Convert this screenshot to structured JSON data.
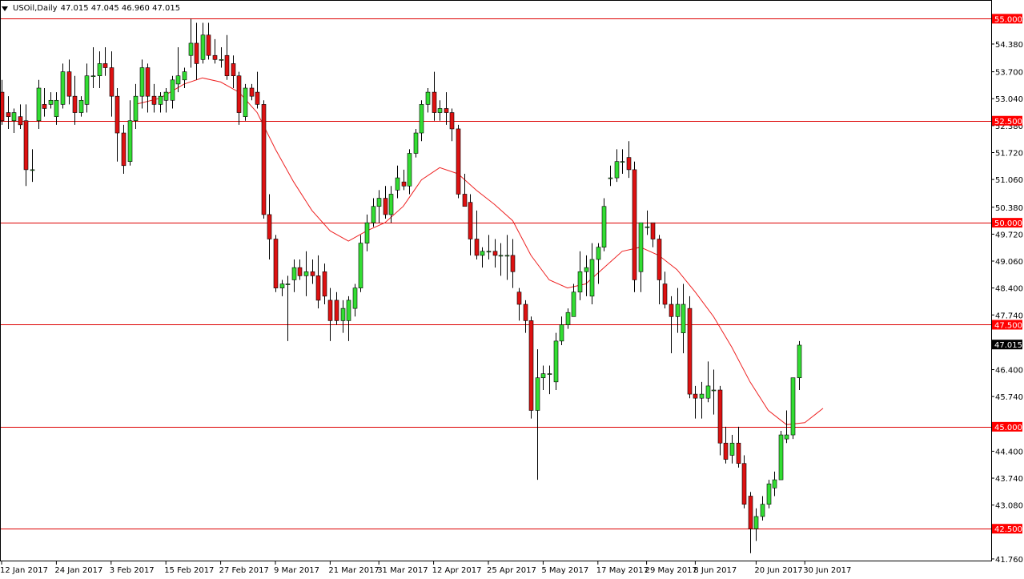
{
  "window": {
    "symbol": "USOil",
    "timeframe": "Daily",
    "header_symbol_tf": "USOil,Daily",
    "ohlc_text": "47.015 47.045 46.960 47.015"
  },
  "colors": {
    "bull": "#33dd33",
    "bear": "#dd1111",
    "level_line": "#dd0000",
    "ma_line": "#ee2222",
    "axis": "#000000",
    "current_tag_bg": "#000000",
    "level_tag_bg": "#ff0000"
  },
  "chart_data": {
    "type": "candlestick",
    "y_axis": {
      "min": 41.7,
      "max": 55.4,
      "ticks": [
        "55.000",
        "54.380",
        "53.700",
        "53.040",
        "52.380",
        "51.720",
        "51.060",
        "50.380",
        "49.720",
        "49.060",
        "48.400",
        "47.740",
        "46.400",
        "45.740",
        "44.400",
        "43.740",
        "43.080",
        "41.760"
      ]
    },
    "x_axis": {
      "tick_labels": [
        "12 Jan 2017",
        "24 Jan 2017",
        "3 Feb 2017",
        "15 Feb 2017",
        "27 Feb 2017",
        "9 Mar 2017",
        "21 Mar 2017",
        "31 Mar 2017",
        "12 Apr 2017",
        "25 Apr 2017",
        "5 May 2017",
        "17 May 2017",
        "29 May 2017",
        "8 Jun 2017",
        "20 Jun 2017",
        "30 Jun 2017"
      ],
      "tick_bar_index": [
        0,
        9,
        18,
        27,
        36,
        45,
        54,
        62,
        71,
        80,
        89,
        98,
        106,
        114,
        124,
        132
      ]
    },
    "horizontal_levels": [
      {
        "value": 55.0,
        "label": "55.000"
      },
      {
        "value": 52.5,
        "label": "52.500"
      },
      {
        "value": 50.0,
        "label": "50.000"
      },
      {
        "value": 47.5,
        "label": "47.500"
      },
      {
        "value": 45.0,
        "label": "45.000"
      },
      {
        "value": 42.5,
        "label": "42.500"
      }
    ],
    "current_price": {
      "value": 47.015,
      "label": "47.015"
    },
    "moving_average": {
      "type": "SMA",
      "points": [
        {
          "i": 22,
          "v": 52.9
        },
        {
          "i": 26,
          "v": 53.05
        },
        {
          "i": 30,
          "v": 53.4
        },
        {
          "i": 33,
          "v": 53.55
        },
        {
          "i": 36,
          "v": 53.45
        },
        {
          "i": 39,
          "v": 53.2
        },
        {
          "i": 42,
          "v": 52.7
        },
        {
          "i": 45,
          "v": 51.8
        },
        {
          "i": 48,
          "v": 51.0
        },
        {
          "i": 51,
          "v": 50.3
        },
        {
          "i": 54,
          "v": 49.8
        },
        {
          "i": 57,
          "v": 49.55
        },
        {
          "i": 60,
          "v": 49.8
        },
        {
          "i": 63,
          "v": 50.0
        },
        {
          "i": 66,
          "v": 50.4
        },
        {
          "i": 69,
          "v": 51.05
        },
        {
          "i": 72,
          "v": 51.35
        },
        {
          "i": 75,
          "v": 51.2
        },
        {
          "i": 78,
          "v": 50.8
        },
        {
          "i": 81,
          "v": 50.45
        },
        {
          "i": 84,
          "v": 50.05
        },
        {
          "i": 87,
          "v": 49.2
        },
        {
          "i": 90,
          "v": 48.6
        },
        {
          "i": 93,
          "v": 48.4
        },
        {
          "i": 96,
          "v": 48.5
        },
        {
          "i": 99,
          "v": 48.9
        },
        {
          "i": 102,
          "v": 49.3
        },
        {
          "i": 105,
          "v": 49.4
        },
        {
          "i": 108,
          "v": 49.2
        },
        {
          "i": 111,
          "v": 48.85
        },
        {
          "i": 114,
          "v": 48.3
        },
        {
          "i": 117,
          "v": 47.7
        },
        {
          "i": 120,
          "v": 46.95
        },
        {
          "i": 123,
          "v": 46.1
        },
        {
          "i": 126,
          "v": 45.4
        },
        {
          "i": 129,
          "v": 45.05
        },
        {
          "i": 132,
          "v": 45.1
        },
        {
          "i": 135,
          "v": 45.45
        }
      ]
    },
    "candles": [
      {
        "o": 53.2,
        "h": 53.5,
        "l": 52.4,
        "c": 52.5
      },
      {
        "o": 52.7,
        "h": 53.1,
        "l": 52.3,
        "c": 52.6
      },
      {
        "o": 52.5,
        "h": 52.8,
        "l": 52.2,
        "c": 52.7
      },
      {
        "o": 52.6,
        "h": 52.9,
        "l": 52.3,
        "c": 52.4
      },
      {
        "o": 52.5,
        "h": 52.9,
        "l": 50.9,
        "c": 51.3
      },
      {
        "o": 51.3,
        "h": 51.8,
        "l": 51.0,
        "c": 51.3
      },
      {
        "o": 52.5,
        "h": 53.5,
        "l": 52.3,
        "c": 53.3
      },
      {
        "o": 52.9,
        "h": 53.3,
        "l": 52.6,
        "c": 52.8
      },
      {
        "o": 52.9,
        "h": 53.2,
        "l": 52.8,
        "c": 53.0
      },
      {
        "o": 52.6,
        "h": 53.2,
        "l": 52.4,
        "c": 53.0
      },
      {
        "o": 52.9,
        "h": 53.9,
        "l": 52.8,
        "c": 53.7
      },
      {
        "o": 53.7,
        "h": 54.0,
        "l": 52.9,
        "c": 53.1
      },
      {
        "o": 53.1,
        "h": 53.6,
        "l": 52.4,
        "c": 52.7
      },
      {
        "o": 52.7,
        "h": 53.1,
        "l": 52.6,
        "c": 53.0
      },
      {
        "o": 52.9,
        "h": 53.9,
        "l": 52.7,
        "c": 53.6
      },
      {
        "o": 53.6,
        "h": 54.3,
        "l": 53.3,
        "c": 53.6
      },
      {
        "o": 53.6,
        "h": 54.2,
        "l": 53.3,
        "c": 53.9
      },
      {
        "o": 53.9,
        "h": 54.3,
        "l": 53.6,
        "c": 53.8
      },
      {
        "o": 53.8,
        "h": 54.2,
        "l": 52.6,
        "c": 53.1
      },
      {
        "o": 53.1,
        "h": 53.3,
        "l": 51.5,
        "c": 52.2
      },
      {
        "o": 52.2,
        "h": 52.4,
        "l": 51.2,
        "c": 51.4
      },
      {
        "o": 51.5,
        "h": 53.0,
        "l": 51.4,
        "c": 52.5
      },
      {
        "o": 52.5,
        "h": 53.4,
        "l": 52.3,
        "c": 53.1
      },
      {
        "o": 53.1,
        "h": 54.0,
        "l": 52.8,
        "c": 53.8
      },
      {
        "o": 53.8,
        "h": 53.9,
        "l": 52.7,
        "c": 53.1
      },
      {
        "o": 53.1,
        "h": 53.4,
        "l": 52.7,
        "c": 52.9
      },
      {
        "o": 52.9,
        "h": 53.2,
        "l": 52.7,
        "c": 53.1
      },
      {
        "o": 53.0,
        "h": 53.3,
        "l": 52.7,
        "c": 53.2
      },
      {
        "o": 53.0,
        "h": 53.6,
        "l": 52.8,
        "c": 53.5
      },
      {
        "o": 53.4,
        "h": 54.3,
        "l": 53.2,
        "c": 53.6
      },
      {
        "o": 53.5,
        "h": 53.8,
        "l": 53.3,
        "c": 53.7
      },
      {
        "o": 54.1,
        "h": 55.0,
        "l": 53.8,
        "c": 54.4
      },
      {
        "o": 54.4,
        "h": 54.9,
        "l": 53.5,
        "c": 53.9
      },
      {
        "o": 54.0,
        "h": 54.9,
        "l": 53.9,
        "c": 54.6
      },
      {
        "o": 54.6,
        "h": 54.9,
        "l": 54.0,
        "c": 54.1
      },
      {
        "o": 54.1,
        "h": 54.5,
        "l": 53.9,
        "c": 54.0
      },
      {
        "o": 54.0,
        "h": 54.3,
        "l": 53.8,
        "c": 54.0
      },
      {
        "o": 54.1,
        "h": 54.6,
        "l": 53.5,
        "c": 53.6
      },
      {
        "o": 53.9,
        "h": 54.1,
        "l": 53.3,
        "c": 53.6
      },
      {
        "o": 53.6,
        "h": 53.7,
        "l": 52.4,
        "c": 52.7
      },
      {
        "o": 52.6,
        "h": 53.4,
        "l": 52.5,
        "c": 53.3
      },
      {
        "o": 53.3,
        "h": 53.4,
        "l": 53.0,
        "c": 53.1
      },
      {
        "o": 53.2,
        "h": 53.7,
        "l": 52.8,
        "c": 52.9
      },
      {
        "o": 52.9,
        "h": 53.0,
        "l": 50.1,
        "c": 50.2
      },
      {
        "o": 50.2,
        "h": 50.7,
        "l": 49.1,
        "c": 49.6
      },
      {
        "o": 49.6,
        "h": 49.7,
        "l": 48.3,
        "c": 48.4
      },
      {
        "o": 48.4,
        "h": 48.6,
        "l": 48.2,
        "c": 48.5
      },
      {
        "o": 48.5,
        "h": 48.7,
        "l": 47.1,
        "c": 48.5
      },
      {
        "o": 48.6,
        "h": 49.1,
        "l": 48.3,
        "c": 48.9
      },
      {
        "o": 48.9,
        "h": 49.1,
        "l": 48.6,
        "c": 48.7
      },
      {
        "o": 48.7,
        "h": 49.3,
        "l": 48.2,
        "c": 48.8
      },
      {
        "o": 48.8,
        "h": 49.1,
        "l": 48.5,
        "c": 48.7
      },
      {
        "o": 48.7,
        "h": 49.2,
        "l": 47.9,
        "c": 48.1
      },
      {
        "o": 48.8,
        "h": 49.0,
        "l": 48.0,
        "c": 48.2
      },
      {
        "o": 48.1,
        "h": 48.4,
        "l": 47.1,
        "c": 47.6
      },
      {
        "o": 48.1,
        "h": 48.3,
        "l": 47.5,
        "c": 47.6
      },
      {
        "o": 47.6,
        "h": 48.1,
        "l": 47.3,
        "c": 47.9
      },
      {
        "o": 47.6,
        "h": 48.2,
        "l": 47.1,
        "c": 48.1
      },
      {
        "o": 47.9,
        "h": 48.5,
        "l": 47.7,
        "c": 48.4
      },
      {
        "o": 48.4,
        "h": 49.7,
        "l": 48.3,
        "c": 49.5
      },
      {
        "o": 49.5,
        "h": 50.2,
        "l": 49.3,
        "c": 50.0
      },
      {
        "o": 50.0,
        "h": 50.6,
        "l": 49.9,
        "c": 50.4
      },
      {
        "o": 50.4,
        "h": 50.8,
        "l": 50.0,
        "c": 50.6
      },
      {
        "o": 50.6,
        "h": 50.9,
        "l": 50.1,
        "c": 50.2
      },
      {
        "o": 50.2,
        "h": 50.9,
        "l": 50.0,
        "c": 50.7
      },
      {
        "o": 50.8,
        "h": 51.4,
        "l": 50.6,
        "c": 51.1
      },
      {
        "o": 51.0,
        "h": 51.3,
        "l": 50.8,
        "c": 50.9
      },
      {
        "o": 50.9,
        "h": 51.8,
        "l": 50.7,
        "c": 51.7
      },
      {
        "o": 51.7,
        "h": 52.3,
        "l": 51.6,
        "c": 52.2
      },
      {
        "o": 52.2,
        "h": 53.0,
        "l": 52.0,
        "c": 52.9
      },
      {
        "o": 52.9,
        "h": 53.3,
        "l": 52.7,
        "c": 53.2
      },
      {
        "o": 53.2,
        "h": 53.7,
        "l": 52.5,
        "c": 52.7
      },
      {
        "o": 52.7,
        "h": 53.0,
        "l": 52.5,
        "c": 52.8
      },
      {
        "o": 52.8,
        "h": 53.2,
        "l": 52.4,
        "c": 52.7
      },
      {
        "o": 52.7,
        "h": 52.8,
        "l": 52.0,
        "c": 52.3
      },
      {
        "o": 52.3,
        "h": 52.4,
        "l": 50.6,
        "c": 50.7
      },
      {
        "o": 50.7,
        "h": 51.2,
        "l": 50.4,
        "c": 50.4
      },
      {
        "o": 50.5,
        "h": 50.7,
        "l": 49.2,
        "c": 49.6
      },
      {
        "o": 49.6,
        "h": 50.3,
        "l": 49.1,
        "c": 49.2
      },
      {
        "o": 49.2,
        "h": 49.4,
        "l": 48.9,
        "c": 49.3
      },
      {
        "o": 49.3,
        "h": 49.7,
        "l": 49.1,
        "c": 49.3
      },
      {
        "o": 49.3,
        "h": 49.6,
        "l": 48.9,
        "c": 49.2
      },
      {
        "o": 49.2,
        "h": 49.5,
        "l": 48.7,
        "c": 49.2
      },
      {
        "o": 49.2,
        "h": 49.7,
        "l": 48.6,
        "c": 49.2
      },
      {
        "o": 49.2,
        "h": 49.6,
        "l": 48.4,
        "c": 48.8
      },
      {
        "o": 48.3,
        "h": 48.4,
        "l": 47.6,
        "c": 48.0
      },
      {
        "o": 48.0,
        "h": 48.1,
        "l": 47.3,
        "c": 47.6
      },
      {
        "o": 47.6,
        "h": 47.7,
        "l": 45.2,
        "c": 45.4
      },
      {
        "o": 45.4,
        "h": 46.9,
        "l": 43.7,
        "c": 46.2
      },
      {
        "o": 46.2,
        "h": 46.5,
        "l": 45.9,
        "c": 46.3
      },
      {
        "o": 46.3,
        "h": 46.5,
        "l": 45.8,
        "c": 46.3
      },
      {
        "o": 46.1,
        "h": 47.3,
        "l": 45.9,
        "c": 47.1
      },
      {
        "o": 47.1,
        "h": 47.7,
        "l": 47.0,
        "c": 47.5
      },
      {
        "o": 47.5,
        "h": 47.9,
        "l": 47.4,
        "c": 47.8
      },
      {
        "o": 47.7,
        "h": 48.5,
        "l": 47.7,
        "c": 48.3
      },
      {
        "o": 48.3,
        "h": 49.3,
        "l": 48.1,
        "c": 48.8
      },
      {
        "o": 48.8,
        "h": 49.2,
        "l": 48.2,
        "c": 48.9
      },
      {
        "o": 48.2,
        "h": 49.5,
        "l": 48.0,
        "c": 49.1
      },
      {
        "o": 49.1,
        "h": 49.5,
        "l": 48.5,
        "c": 49.4
      },
      {
        "o": 49.4,
        "h": 50.6,
        "l": 49.3,
        "c": 50.4
      },
      {
        "o": 51.1,
        "h": 51.4,
        "l": 50.9,
        "c": 51.1
      },
      {
        "o": 51.1,
        "h": 51.8,
        "l": 51.0,
        "c": 51.5
      },
      {
        "o": 51.5,
        "h": 51.8,
        "l": 51.2,
        "c": 51.5
      },
      {
        "o": 51.6,
        "h": 52.0,
        "l": 51.1,
        "c": 51.3
      },
      {
        "o": 51.3,
        "h": 51.5,
        "l": 48.3,
        "c": 48.6
      },
      {
        "o": 48.8,
        "h": 50.0,
        "l": 48.3,
        "c": 50.0
      },
      {
        "o": 49.9,
        "h": 50.3,
        "l": 49.7,
        "c": 49.9
      },
      {
        "o": 50.0,
        "h": 50.0,
        "l": 49.4,
        "c": 49.6
      },
      {
        "o": 49.6,
        "h": 49.7,
        "l": 48.0,
        "c": 48.6
      },
      {
        "o": 48.5,
        "h": 48.8,
        "l": 47.9,
        "c": 48.0
      },
      {
        "o": 48.0,
        "h": 48.2,
        "l": 46.8,
        "c": 47.7
      },
      {
        "o": 47.7,
        "h": 48.4,
        "l": 47.3,
        "c": 48.0
      },
      {
        "o": 47.3,
        "h": 48.5,
        "l": 46.8,
        "c": 48.0
      },
      {
        "o": 47.9,
        "h": 48.2,
        "l": 45.7,
        "c": 45.8
      },
      {
        "o": 45.8,
        "h": 46.0,
        "l": 45.2,
        "c": 45.7
      },
      {
        "o": 45.7,
        "h": 46.1,
        "l": 45.2,
        "c": 45.8
      },
      {
        "o": 45.7,
        "h": 46.6,
        "l": 45.6,
        "c": 46.0
      },
      {
        "o": 45.9,
        "h": 46.4,
        "l": 45.3,
        "c": 45.9
      },
      {
        "o": 45.9,
        "h": 46.0,
        "l": 44.3,
        "c": 44.6
      },
      {
        "o": 44.6,
        "h": 45.0,
        "l": 44.1,
        "c": 44.2
      },
      {
        "o": 44.3,
        "h": 44.8,
        "l": 44.1,
        "c": 44.6
      },
      {
        "o": 44.6,
        "h": 45.0,
        "l": 44.0,
        "c": 44.1
      },
      {
        "o": 44.1,
        "h": 44.3,
        "l": 43.0,
        "c": 43.1
      },
      {
        "o": 43.3,
        "h": 43.4,
        "l": 41.9,
        "c": 42.5
      },
      {
        "o": 42.5,
        "h": 43.0,
        "l": 42.2,
        "c": 42.8
      },
      {
        "o": 42.8,
        "h": 43.3,
        "l": 42.7,
        "c": 43.1
      },
      {
        "o": 43.1,
        "h": 43.7,
        "l": 43.0,
        "c": 43.6
      },
      {
        "o": 43.5,
        "h": 43.9,
        "l": 43.3,
        "c": 43.7
      },
      {
        "o": 43.7,
        "h": 44.9,
        "l": 43.7,
        "c": 44.8
      },
      {
        "o": 44.7,
        "h": 45.4,
        "l": 44.6,
        "c": 44.8
      },
      {
        "o": 44.8,
        "h": 45.2,
        "l": 44.7,
        "c": 46.2
      },
      {
        "o": 46.2,
        "h": 47.1,
        "l": 45.9,
        "c": 47.0
      }
    ]
  }
}
